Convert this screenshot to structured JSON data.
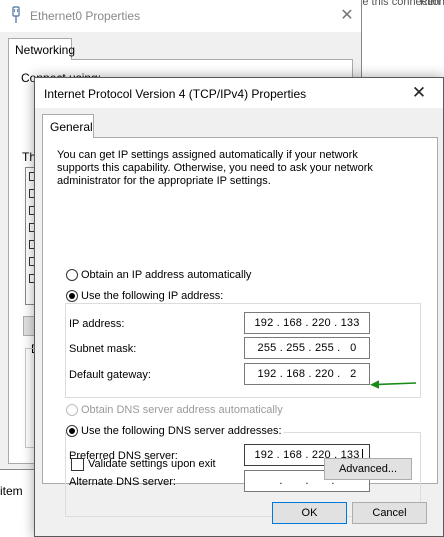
{
  "background_window": {
    "title": "Ethernet0 Properties",
    "close_glyph": "✕",
    "tab_label": "Networking",
    "fragment_connect": "Connect using:",
    "fragment_this": "Th",
    "fragment_d": "D",
    "right_fragments": [
      "Diagnose this connection",
      "Ren"
    ],
    "bottom_text": "item"
  },
  "dialog": {
    "title": "Internet Protocol Version 4 (TCP/IPv4) Properties",
    "close_glyph": "✕",
    "tab_label": "General",
    "description": "You can get IP settings assigned automatically if your network supports this capability. Otherwise, you need to ask your network administrator for the appropriate IP settings.",
    "ip_mode": {
      "auto_label": "Obtain an IP address automatically",
      "manual_label": "Use the following IP address:",
      "selected": "manual"
    },
    "ip_fields": {
      "ip_address": {
        "label": "IP address:",
        "value": "192 . 168 . 220 . 133"
      },
      "subnet_mask": {
        "label": "Subnet mask:",
        "value": "255 . 255 . 255 .   0"
      },
      "default_gateway": {
        "label": "Default gateway:",
        "value": "192 . 168 . 220 .   2"
      }
    },
    "dns_mode": {
      "auto_label": "Obtain DNS server address automatically",
      "manual_label": "Use the following DNS server addresses:",
      "selected": "manual"
    },
    "dns_fields": {
      "preferred": {
        "label": "Preferred DNS server:",
        "value": "192 . 168 . 220 . 133"
      },
      "alternate": {
        "label": "Alternate DNS server:",
        "value": "    .       .       .    "
      }
    },
    "validate_label": "Validate settings upon exit",
    "validate_checked": false,
    "advanced_button": "Advanced...",
    "ok_button": "OK",
    "cancel_button": "Cancel"
  },
  "colors": {
    "annotation_arrow": "#1a8a1a",
    "focus_border": "#0078d7"
  }
}
